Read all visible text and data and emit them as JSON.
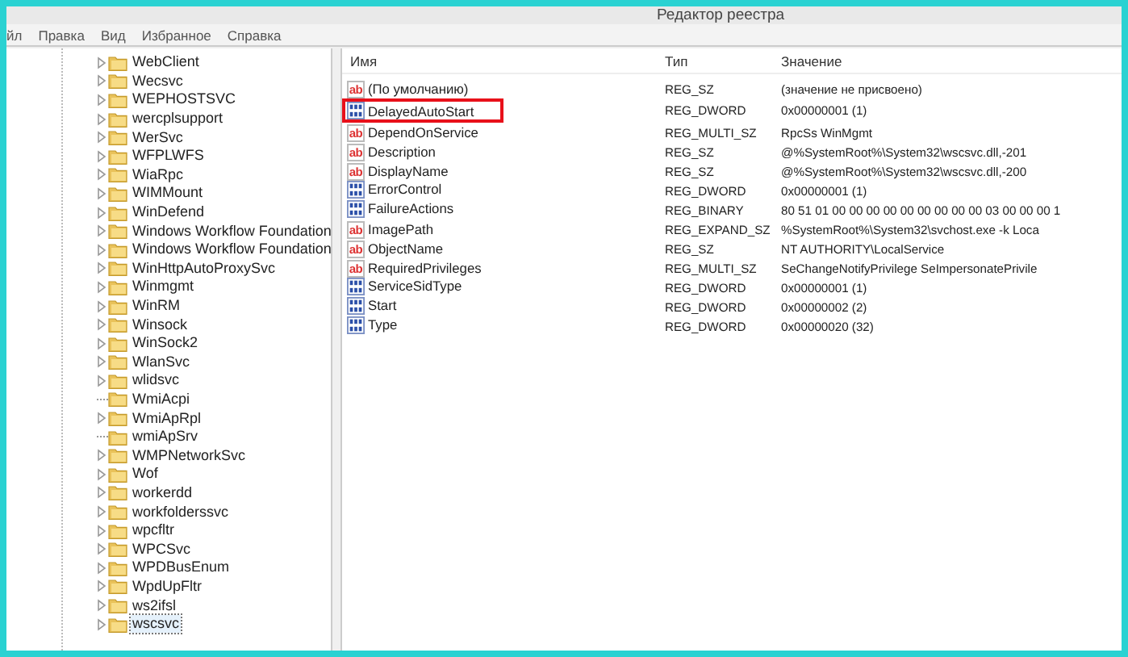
{
  "window": {
    "title": "Редактор реестра"
  },
  "menu": [
    {
      "label": "йл"
    },
    {
      "label": "Правка"
    },
    {
      "label": "Вид"
    },
    {
      "label": "Избранное"
    },
    {
      "label": "Справка"
    }
  ],
  "tree": {
    "items": [
      {
        "label": "WebClient",
        "expandable": true,
        "selected": false
      },
      {
        "label": "Wecsvc",
        "expandable": true,
        "selected": false
      },
      {
        "label": "WEPHOSTSVC",
        "expandable": true,
        "selected": false
      },
      {
        "label": "wercplsupport",
        "expandable": true,
        "selected": false
      },
      {
        "label": "WerSvc",
        "expandable": true,
        "selected": false
      },
      {
        "label": "WFPLWFS",
        "expandable": true,
        "selected": false
      },
      {
        "label": "WiaRpc",
        "expandable": true,
        "selected": false
      },
      {
        "label": "WIMMount",
        "expandable": true,
        "selected": false
      },
      {
        "label": "WinDefend",
        "expandable": true,
        "selected": false
      },
      {
        "label": "Windows Workflow Foundation",
        "expandable": true,
        "selected": false
      },
      {
        "label": "Windows Workflow Foundation",
        "expandable": true,
        "selected": false
      },
      {
        "label": "WinHttpAutoProxySvc",
        "expandable": true,
        "selected": false
      },
      {
        "label": "Winmgmt",
        "expandable": true,
        "selected": false
      },
      {
        "label": "WinRM",
        "expandable": true,
        "selected": false
      },
      {
        "label": "Winsock",
        "expandable": true,
        "selected": false
      },
      {
        "label": "WinSock2",
        "expandable": true,
        "selected": false
      },
      {
        "label": "WlanSvc",
        "expandable": true,
        "selected": false
      },
      {
        "label": "wlidsvc",
        "expandable": true,
        "selected": false
      },
      {
        "label": "WmiAcpi",
        "expandable": false,
        "selected": false
      },
      {
        "label": "WmiApRpl",
        "expandable": true,
        "selected": false
      },
      {
        "label": "wmiApSrv",
        "expandable": false,
        "selected": false
      },
      {
        "label": "WMPNetworkSvc",
        "expandable": true,
        "selected": false
      },
      {
        "label": "Wof",
        "expandable": true,
        "selected": false
      },
      {
        "label": "workerdd",
        "expandable": true,
        "selected": false
      },
      {
        "label": "workfolderssvc",
        "expandable": true,
        "selected": false
      },
      {
        "label": "wpcfltr",
        "expandable": true,
        "selected": false
      },
      {
        "label": "WPCSvc",
        "expandable": true,
        "selected": false
      },
      {
        "label": "WPDBusEnum",
        "expandable": true,
        "selected": false
      },
      {
        "label": "WpdUpFltr",
        "expandable": true,
        "selected": false
      },
      {
        "label": "ws2ifsl",
        "expandable": true,
        "selected": false
      },
      {
        "label": "wscsvc",
        "expandable": true,
        "selected": true
      }
    ]
  },
  "table": {
    "columns": [
      "Имя",
      "Тип",
      "Значение"
    ],
    "rows": [
      {
        "kind": "string",
        "icon_label": "ab",
        "name": "(По умолчанию)",
        "type": "REG_SZ",
        "value": "(значение не присвоено)",
        "highlighted": false
      },
      {
        "kind": "binary",
        "name": "DelayedAutoStart",
        "type": "REG_DWORD",
        "value": "0x00000001 (1)",
        "highlighted": true
      },
      {
        "kind": "string",
        "icon_label": "ab",
        "name": "DependOnService",
        "type": "REG_MULTI_SZ",
        "value": "RpcSs WinMgmt",
        "highlighted": false
      },
      {
        "kind": "string",
        "icon_label": "ab",
        "name": "Description",
        "type": "REG_SZ",
        "value": "@%SystemRoot%\\System32\\wscsvc.dll,-201",
        "highlighted": false
      },
      {
        "kind": "string",
        "icon_label": "ab",
        "name": "DisplayName",
        "type": "REG_SZ",
        "value": "@%SystemRoot%\\System32\\wscsvc.dll,-200",
        "highlighted": false
      },
      {
        "kind": "binary",
        "name": "ErrorControl",
        "type": "REG_DWORD",
        "value": "0x00000001 (1)",
        "highlighted": false
      },
      {
        "kind": "binary",
        "name": "FailureActions",
        "type": "REG_BINARY",
        "value": "80 51 01 00 00 00 00 00 00 00 00 00 03 00 00 00 1",
        "highlighted": false
      },
      {
        "kind": "string",
        "icon_label": "ab",
        "name": "ImagePath",
        "type": "REG_EXPAND_SZ",
        "value": "%SystemRoot%\\System32\\svchost.exe -k Loca",
        "highlighted": false
      },
      {
        "kind": "string",
        "icon_label": "ab",
        "name": "ObjectName",
        "type": "REG_SZ",
        "value": "NT AUTHORITY\\LocalService",
        "highlighted": false
      },
      {
        "kind": "string",
        "icon_label": "ab",
        "name": "RequiredPrivileges",
        "type": "REG_MULTI_SZ",
        "value": "SeChangeNotifyPrivilege SeImpersonatePrivile",
        "highlighted": false
      },
      {
        "kind": "binary",
        "name": "ServiceSidType",
        "type": "REG_DWORD",
        "value": "0x00000001 (1)",
        "highlighted": false
      },
      {
        "kind": "binary",
        "name": "Start",
        "type": "REG_DWORD",
        "value": "0x00000002 (2)",
        "highlighted": false
      },
      {
        "kind": "binary",
        "name": "Type",
        "type": "REG_DWORD",
        "value": "0x00000020 (32)",
        "highlighted": false
      }
    ]
  }
}
